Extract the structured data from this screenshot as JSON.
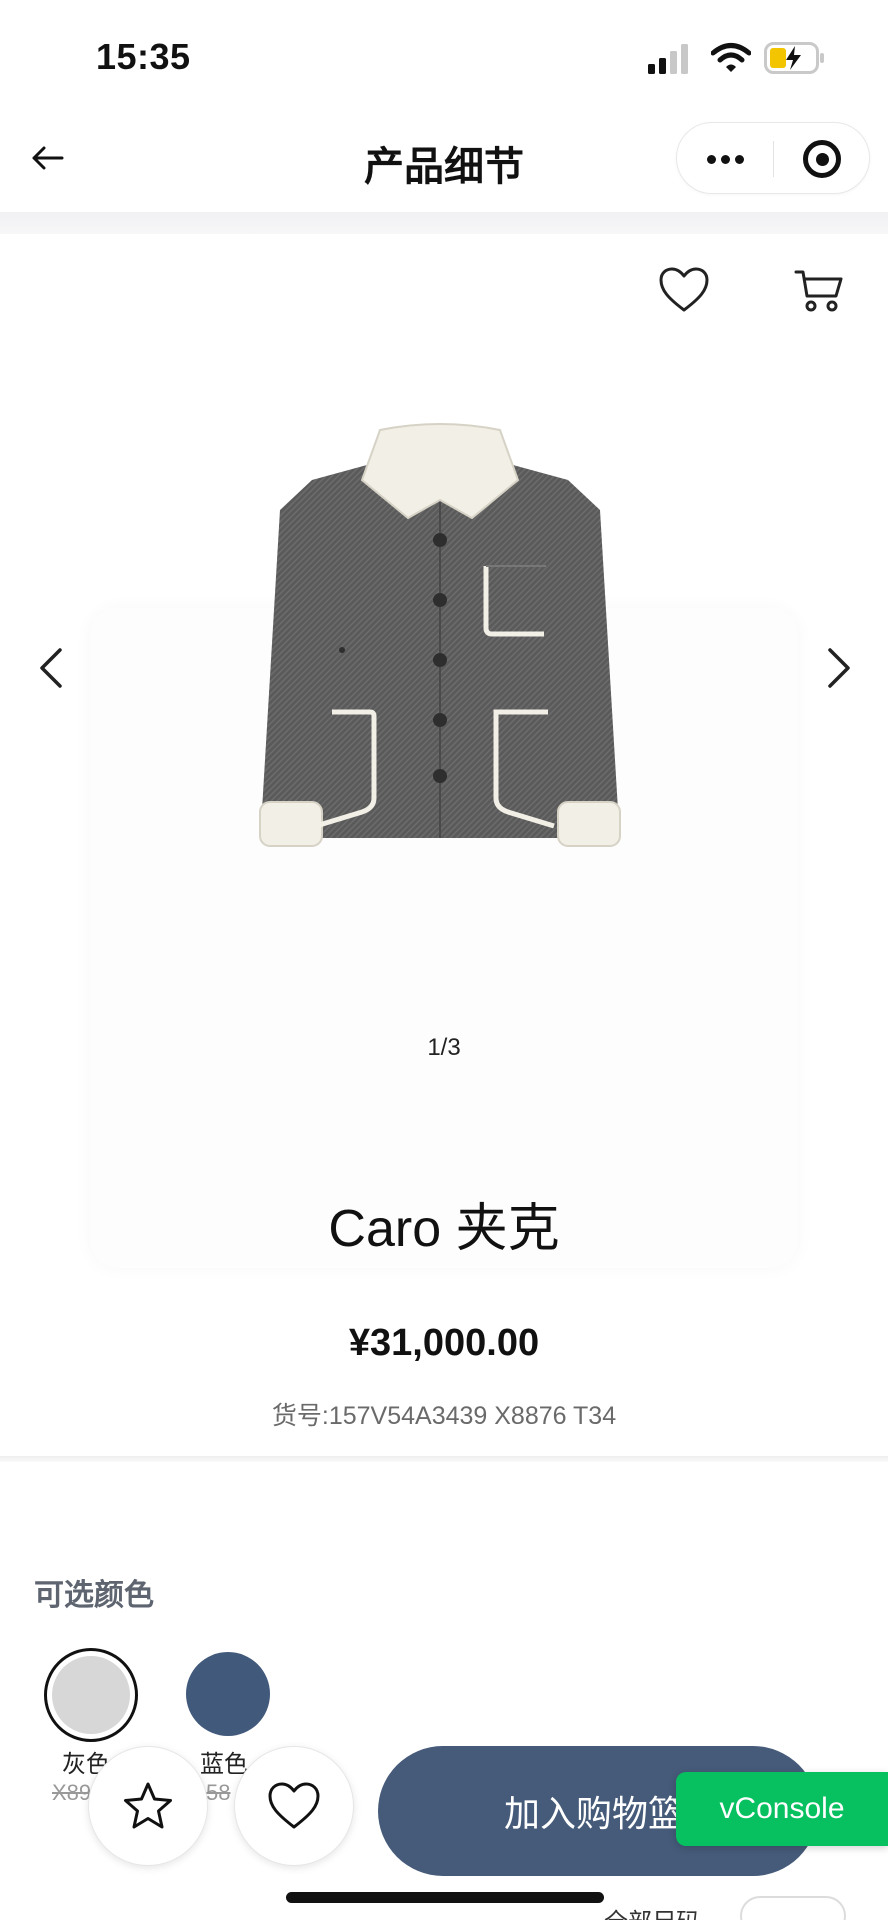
{
  "status_bar": {
    "time": "15:35"
  },
  "nav": {
    "title": "产品细节",
    "back_icon": "arrow-left-icon",
    "more_icon": "more-dots-icon",
    "close_icon": "target-circle-icon"
  },
  "product": {
    "image_pager": "1/3",
    "name": "Caro 夹克",
    "price": "¥31,000.00",
    "sku": "货号:157V54A3439 X8876 T34",
    "image_alt_icon": "jacket-image"
  },
  "colors": {
    "label": "可选颜色",
    "options": [
      {
        "name": "灰色",
        "struck_price": "X89",
        "hex": "#d7d7d7",
        "selected": true
      },
      {
        "name": "蓝色",
        "struck_price": "58",
        "hex": "#41597b",
        "selected": false
      }
    ]
  },
  "actions": {
    "add_to_cart": "加入购物篮",
    "vconsole": "vConsole",
    "bottom_hint": "全部尺码"
  },
  "theme": {
    "accent": "#455b79",
    "vconsole_green": "#07c160"
  }
}
